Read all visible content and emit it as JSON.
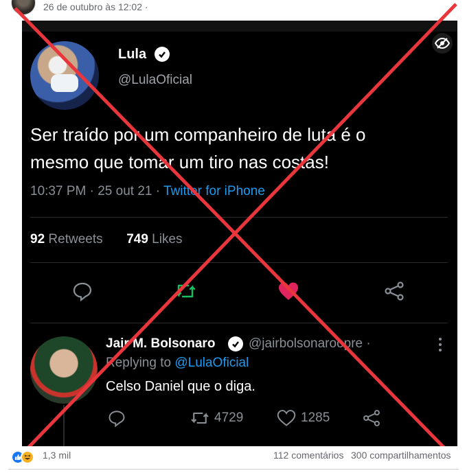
{
  "post": {
    "timestamp": "26 de outubro às 12:02 ·"
  },
  "tweet": {
    "name": "Lula",
    "handle": "@LulaOficial",
    "text_line1": "Ser traído por um companheiro de luta  é o",
    "text_line2": "mesmo que  tomar um tiro nas costas!",
    "time": "10:37 PM · 25 out 21 · ",
    "client": "Twitter for iPhone",
    "retweets_count": "92",
    "retweets_label": " Retweets",
    "likes_count": "749",
    "likes_label": " Likes"
  },
  "reply": {
    "name": "Jair M. Bolsonaro",
    "handle": "@jairbolsonaroopre ·",
    "replying_prefix": "Replying to ",
    "replying_to": "@LulaOficial",
    "text": "Celso Daniel que o diga.",
    "retweets": "4729",
    "likes": "1285"
  },
  "footer": {
    "reactions": "1,3 mil",
    "comments": "112 comentários",
    "shares": "300 compartilhamentos"
  },
  "colors": {
    "twitter_blue": "#1d9bf0",
    "retweet_green": "#17bf63",
    "like_red": "#e0245e",
    "cross_red": "#e8363c",
    "fb_blue": "#1877f2"
  }
}
